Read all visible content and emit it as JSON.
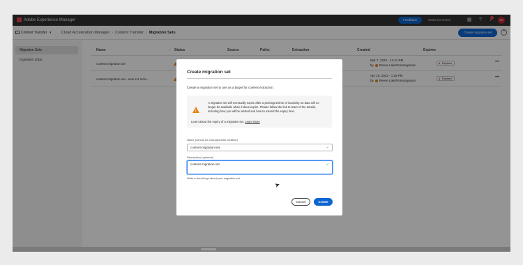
{
  "app": {
    "title": "Adobe Experience Manager"
  },
  "topbar": {
    "feedback_label": "Feedback",
    "org_label": "SMLinCS Demo",
    "icons": [
      "grid-icon",
      "help-icon",
      "bell-icon",
      "avatar"
    ],
    "avatar_initials": "SD"
  },
  "subbar": {
    "product_select": "Content Transfer",
    "breadcrumbs": [
      "Cloud Acceleration Manager",
      "Content Transfer",
      "Migration Sets"
    ],
    "create_button": "Create migration set"
  },
  "sidenav": {
    "items": [
      "Migration Sets",
      "Ingestion Jobs"
    ],
    "active_index": 0
  },
  "table": {
    "headers": [
      "Name",
      "Status",
      "Source",
      "Paths",
      "Extraction",
      "Created",
      "Expires"
    ],
    "rows": [
      {
        "name": "content migration set",
        "status": "Expire",
        "created_date": "Mar 7, 2023 · 12:41 PM",
        "created_by": "by",
        "created_user": "Reeve Lakshminarayanan",
        "expires": "Expired"
      },
      {
        "name": "content migration set - new 4.2 inclu...",
        "status": "Expire",
        "created_date": "Apr 19, 2023 · 1:26 PM",
        "created_by": "by",
        "created_user": "Reeve Lakshminarayanan",
        "expires": "Expired"
      }
    ]
  },
  "dialog": {
    "title": "Create migration set",
    "intro": "Create a migration set to use as a target for content extraction.",
    "warning": {
      "text": "A migration set will eventually expire after a prolonged time of inactivity. Its data will no longer be available when it does expire. Please follow the link to learn of the details, including how you will be alerted and how to extend the expiry time.",
      "learn_prefix": "Learn about the expiry of a migration set.",
      "learn_link": "Learn More"
    },
    "name_label": "Name (cannot be changed after creation)",
    "name_value": "content-migration-set",
    "description_label": "Description (optional)",
    "description_value": "content migration set",
    "description_help": "Write a few things about your migration set.",
    "cancel_label": "Cancel",
    "create_label": "Create"
  },
  "colors": {
    "accent": "#0d66d0",
    "warning": "#e68619",
    "success": "#2d9d78",
    "topbar": "#323232"
  }
}
